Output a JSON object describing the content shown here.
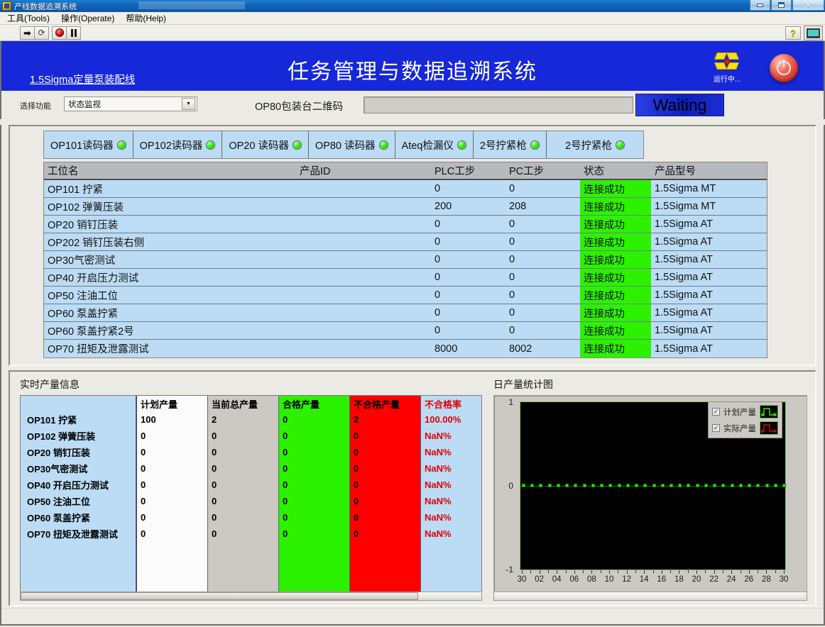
{
  "window": {
    "title": "产线数据追溯系统",
    "buttons": {
      "minimize": "—",
      "maximize": "▣",
      "close": "✕"
    }
  },
  "menubar": {
    "items": [
      {
        "label": "工具(Tools)"
      },
      {
        "label": "操作(Operate)"
      },
      {
        "label": "帮助(Help)"
      }
    ]
  },
  "toolbar": {
    "run_icon": "run-arrow-icon",
    "run_continuous_icon": "run-continuously-icon",
    "abort_icon": "abort-execution-icon",
    "pause_icon": "pause-icon",
    "help_label": "?",
    "monitor_icon": "monitor-icon"
  },
  "banner": {
    "link": "1.5Sigma定量泵装配线",
    "title": "任务管理与数据追溯系统",
    "run_status": "运行中...",
    "run_icon": "fan-running-icon",
    "power_icon": "power-stop-icon"
  },
  "function_row": {
    "select_label": "选择功能",
    "select_value": "状态监视",
    "select_options": [
      "状态监视"
    ],
    "code_label": "OP80包装台二维码",
    "code_value": "",
    "code_placeholder": "",
    "status_badge": "Waiting",
    "status_badge_color": "#1628d8"
  },
  "device_tabs": [
    {
      "label": "OP101读码器",
      "led": "green"
    },
    {
      "label": "OP102读码器",
      "led": "green"
    },
    {
      "label": "OP20 读码器",
      "led": "green"
    },
    {
      "label": "OP80 读码器",
      "led": "green"
    },
    {
      "label": "Ateq检漏仪",
      "led": "green"
    },
    {
      "label": "2号拧紧枪",
      "led": "green"
    },
    {
      "label": "2号拧紧枪",
      "led": "green"
    }
  ],
  "status_grid": {
    "headers": [
      "工位名",
      "产品ID",
      "PLC工步",
      "PC工步",
      "状态",
      "产品型号"
    ],
    "rows": [
      {
        "station": "OP101 拧紧",
        "product_id": "",
        "plc_step": "0",
        "pc_step": "0",
        "state": "连接成功",
        "model": "1.5Sigma MT"
      },
      {
        "station": "OP102 弹簧压装",
        "product_id": "",
        "plc_step": "200",
        "pc_step": "208",
        "state": "连接成功",
        "model": "1.5Sigma MT"
      },
      {
        "station": "OP20 销钉压装",
        "product_id": "",
        "plc_step": "0",
        "pc_step": "0",
        "state": "连接成功",
        "model": "1.5Sigma AT"
      },
      {
        "station": "OP202 销钉压装右侧",
        "product_id": "",
        "plc_step": "0",
        "pc_step": "0",
        "state": "连接成功",
        "model": "1.5Sigma AT"
      },
      {
        "station": "OP30气密测试",
        "product_id": "",
        "plc_step": "0",
        "pc_step": "0",
        "state": "连接成功",
        "model": "1.5Sigma AT"
      },
      {
        "station": "OP40 开启压力测试",
        "product_id": "",
        "plc_step": "0",
        "pc_step": "0",
        "state": "连接成功",
        "model": "1.5Sigma AT"
      },
      {
        "station": "OP50 注油工位",
        "product_id": "",
        "plc_step": "0",
        "pc_step": "0",
        "state": "连接成功",
        "model": "1.5Sigma AT"
      },
      {
        "station": "OP60 泵盖拧紧",
        "product_id": "",
        "plc_step": "0",
        "pc_step": "0",
        "state": "连接成功",
        "model": "1.5Sigma AT"
      },
      {
        "station": "OP60 泵盖拧紧2号",
        "product_id": "",
        "plc_step": "0",
        "pc_step": "0",
        "state": "连接成功",
        "model": "1.5Sigma AT"
      },
      {
        "station": "OP70 扭矩及泄露测试",
        "product_id": "",
        "plc_step": "8000",
        "pc_step": "8002",
        "state": "连接成功",
        "model": "1.5Sigma AT"
      }
    ]
  },
  "production": {
    "section_title": "实时产量信息",
    "headers": [
      "",
      "计划产量",
      "当前总产量",
      "合格产量",
      "不合格产量",
      "不合格率"
    ],
    "rows": [
      {
        "station": "OP101 拧紧",
        "plan": "100",
        "total": "2",
        "pass": "0",
        "fail": "2",
        "rate": "100.00%"
      },
      {
        "station": "OP102 弹簧压装",
        "plan": "0",
        "total": "0",
        "pass": "0",
        "fail": "0",
        "rate": "NaN%"
      },
      {
        "station": "OP20 销钉压装",
        "plan": "0",
        "total": "0",
        "pass": "0",
        "fail": "0",
        "rate": "NaN%"
      },
      {
        "station": "OP30气密测试",
        "plan": "0",
        "total": "0",
        "pass": "0",
        "fail": "0",
        "rate": "NaN%"
      },
      {
        "station": "OP40 开启压力测试",
        "plan": "0",
        "total": "0",
        "pass": "0",
        "fail": "0",
        "rate": "NaN%"
      },
      {
        "station": "OP50 注油工位",
        "plan": "0",
        "total": "0",
        "pass": "0",
        "fail": "0",
        "rate": "NaN%"
      },
      {
        "station": "OP60 泵盖拧紧",
        "plan": "0",
        "total": "0",
        "pass": "0",
        "fail": "0",
        "rate": "NaN%"
      },
      {
        "station": "OP70 扭矩及泄露测试",
        "plan": "0",
        "total": "0",
        "pass": "0",
        "fail": "0",
        "rate": "NaN%"
      }
    ],
    "colors": {
      "pass_bg": "#2cf200",
      "fail_bg": "#ff0000",
      "rate_fg": "#e00000",
      "names_bg": "#bcdcf5"
    }
  },
  "chart_panel": {
    "section_title": "日产量统计图",
    "legend": [
      {
        "label": "计划产量",
        "checked": true,
        "color": "#2cf200"
      },
      {
        "label": "实际产量",
        "checked": true,
        "color": "#e00000"
      }
    ]
  },
  "chart_data": {
    "type": "line",
    "title": "日产量统计图",
    "xlabel": "",
    "ylabel": "",
    "grid": false,
    "legend_position": "top-right",
    "plot_bg": "#000000",
    "ylim": [
      -1,
      1
    ],
    "yticks": [
      1,
      0,
      -1
    ],
    "ytick_labels": [
      "1",
      "0",
      "-1"
    ],
    "x": [
      "30",
      "01",
      "02",
      "03",
      "04",
      "05",
      "06",
      "07",
      "08",
      "09",
      "10",
      "11",
      "12",
      "13",
      "14",
      "15",
      "16",
      "17",
      "18",
      "19",
      "20",
      "21",
      "22",
      "23",
      "24",
      "25",
      "26",
      "27",
      "28",
      "29",
      "30"
    ],
    "xtick_labels": [
      "30",
      "02",
      "04",
      "06",
      "08",
      "10",
      "12",
      "14",
      "16",
      "18",
      "20",
      "22",
      "24",
      "26",
      "28",
      "30"
    ],
    "series": [
      {
        "name": "计划产量",
        "color": "#2cf200",
        "values": [
          0,
          0,
          0,
          0,
          0,
          0,
          0,
          0,
          0,
          0,
          0,
          0,
          0,
          0,
          0,
          0,
          0,
          0,
          0,
          0,
          0,
          0,
          0,
          0,
          0,
          0,
          0,
          0,
          0,
          0,
          0
        ]
      },
      {
        "name": "实际产量",
        "color": "#e00000",
        "values": [
          0,
          0,
          0,
          0,
          0,
          0,
          0,
          0,
          0,
          0,
          0,
          0,
          0,
          0,
          0,
          0,
          0,
          0,
          0,
          0,
          0,
          0,
          0,
          0,
          0,
          0,
          0,
          0,
          0,
          0,
          0
        ]
      }
    ]
  }
}
